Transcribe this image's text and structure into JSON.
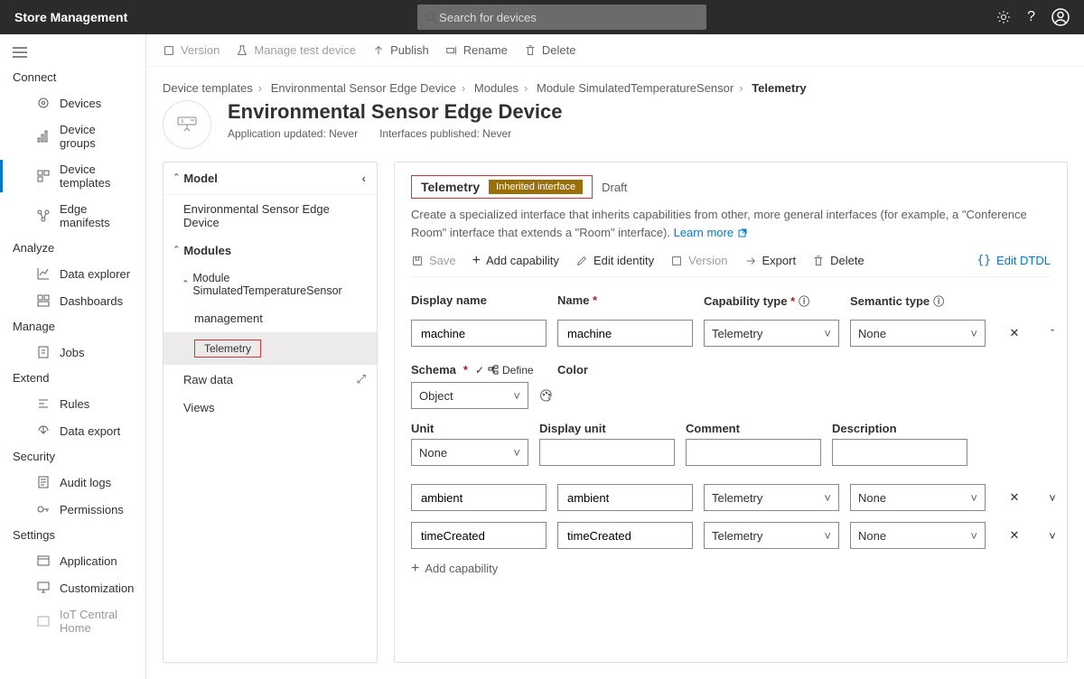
{
  "app_title": "Store Management",
  "search_placeholder": "Search for devices",
  "toolbar": {
    "version": "Version",
    "manage": "Manage test device",
    "publish": "Publish",
    "rename": "Rename",
    "delete": "Delete"
  },
  "breadcrumb": {
    "a": "Device templates",
    "b": "Environmental Sensor Edge Device",
    "c": "Modules",
    "d": "Module SimulatedTemperatureSensor",
    "current": "Telemetry"
  },
  "page": {
    "title": "Environmental Sensor Edge Device",
    "sub1": "Application updated: Never",
    "sub2": "Interfaces published: Never"
  },
  "nav": {
    "connect": "Connect",
    "devices": "Devices",
    "deviceGroups": "Device groups",
    "deviceTemplates": "Device templates",
    "edge": "Edge manifests",
    "analyze": "Analyze",
    "dataExplorer": "Data explorer",
    "dashboards": "Dashboards",
    "manage": "Manage",
    "jobs": "Jobs",
    "extend": "Extend",
    "rules": "Rules",
    "dataExport": "Data export",
    "security": "Security",
    "audit": "Audit logs",
    "permissions": "Permissions",
    "settings": "Settings",
    "application": "Application",
    "customization": "Customization",
    "iot": "IoT Central Home"
  },
  "tree": {
    "model": "Model",
    "root": "Environmental Sensor Edge Device",
    "modules": "Modules",
    "module": "Module SimulatedTemperatureSensor",
    "management": "management",
    "telemetry": "Telemetry",
    "raw": "Raw data",
    "views": "Views"
  },
  "editor": {
    "title": "Telemetry",
    "badge": "Inherited interface",
    "draft": "Draft",
    "desc_a": "Create a specialized interface that inherits capabilities from other, more general interfaces (for example, a \"Conference Room\" interface that extends a \"Room\" interface). ",
    "learn": "Learn more",
    "tb": {
      "save": "Save",
      "add": "Add capability",
      "edit": "Edit identity",
      "version": "Version",
      "export": "Export",
      "delete": "Delete",
      "dtdl": "Edit DTDL"
    },
    "headers": {
      "display": "Display name",
      "name": "Name",
      "cap": "Capability type",
      "sem": "Semantic type"
    },
    "rows": [
      {
        "display": "machine",
        "name": "machine",
        "cap": "Telemetry",
        "sem": "None",
        "expanded": true
      },
      {
        "display": "ambient",
        "name": "ambient",
        "cap": "Telemetry",
        "sem": "None",
        "expanded": false
      },
      {
        "display": "timeCreated",
        "name": "timeCreated",
        "cap": "Telemetry",
        "sem": "None",
        "expanded": false
      }
    ],
    "detail": {
      "schema": "Schema",
      "define": "Define",
      "schema_val": "Object",
      "color": "Color",
      "unit": "Unit",
      "unit_val": "None",
      "dunit": "Display unit",
      "comment": "Comment",
      "description": "Description"
    },
    "addcap": "Add capability"
  }
}
